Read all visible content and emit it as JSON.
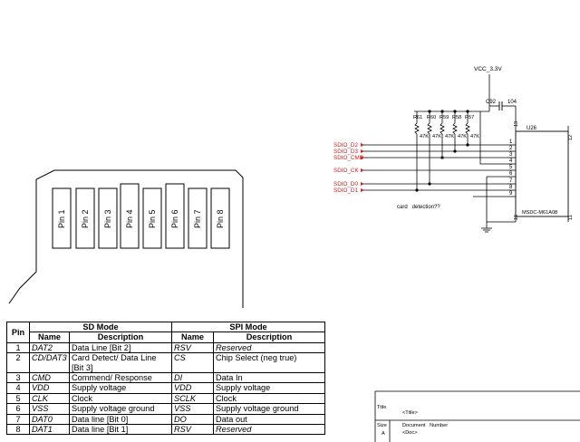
{
  "card": {
    "pins": [
      "Pin 1",
      "Pin 2",
      "Pin 3",
      "Pin 4",
      "Pin 5",
      "Pin 6",
      "Pin 7",
      "Pin 8"
    ]
  },
  "table": {
    "pin_header": "Pin",
    "sd_header": "SD Mode",
    "spi_header": "SPI Mode",
    "name_header": "Name",
    "desc_header": "Description",
    "rows": [
      {
        "pin": "1",
        "sd_name": "DAT2",
        "sd_desc": "Data Line [Bit 2]",
        "spi_name": "RSV",
        "spi_desc": "Reserved"
      },
      {
        "pin": "2",
        "sd_name": "CD/DAT3",
        "sd_desc": "Card Detect/ Data Line [Bit 3]",
        "spi_name": "CS",
        "spi_desc": "Chip Select (neg true)"
      },
      {
        "pin": "3",
        "sd_name": "CMD",
        "sd_desc": "Commend/ Response",
        "spi_name": "DI",
        "spi_desc": "Data In"
      },
      {
        "pin": "4",
        "sd_name": "VDD",
        "sd_desc": "Supply voltage",
        "spi_name": "VDD",
        "spi_desc": "Supply voltage"
      },
      {
        "pin": "5",
        "sd_name": "CLK",
        "sd_desc": "Clock",
        "spi_name": "SCLK",
        "spi_desc": "Clock"
      },
      {
        "pin": "6",
        "sd_name": "VSS",
        "sd_desc": "Supply voltage ground",
        "spi_name": "VSS",
        "spi_desc": "Supply voltage ground"
      },
      {
        "pin": "7",
        "sd_name": "DAT0",
        "sd_desc": "Data line [Bit 0]",
        "spi_name": "DO",
        "spi_desc": "Data out"
      },
      {
        "pin": "8",
        "sd_name": "DAT1",
        "sd_desc": "Data line [Bit 1]",
        "spi_name": "RSV",
        "spi_desc": "Reserved"
      }
    ]
  },
  "schematic": {
    "vcc_label": "VCC_3.3V",
    "cap_label": "C92",
    "cap_value": "104",
    "chip_ref": "U26",
    "chip_part": "MSDC-M61A08",
    "resistors": [
      {
        "ref": "R61",
        "value": "47K"
      },
      {
        "ref": "R60",
        "value": "47K"
      },
      {
        "ref": "R59",
        "value": "47K"
      },
      {
        "ref": "R58",
        "value": "47K"
      },
      {
        "ref": "R57",
        "value": "47K"
      }
    ],
    "signals": [
      "SDIO_D2",
      "SDIO_D3",
      "SDIO_CMD",
      "SDIO_CK",
      "SDIO_D0",
      "SDIO_D1"
    ],
    "chip_pin_numbers": [
      "1",
      "2",
      "3",
      "4",
      "5",
      "6",
      "7",
      "8",
      "9"
    ],
    "chip_side_numbers": [
      "10",
      "11",
      "12",
      "13"
    ],
    "annotation": "card   detection??",
    "colors": {
      "net_label": "#d42020",
      "wire": "#000000"
    }
  },
  "title_block": {
    "title_label": "Title",
    "title_value": "<Title>",
    "size_label": "Size",
    "size_value": "A",
    "doc_label": "Document   Number",
    "doc_value": "<Doc>"
  }
}
